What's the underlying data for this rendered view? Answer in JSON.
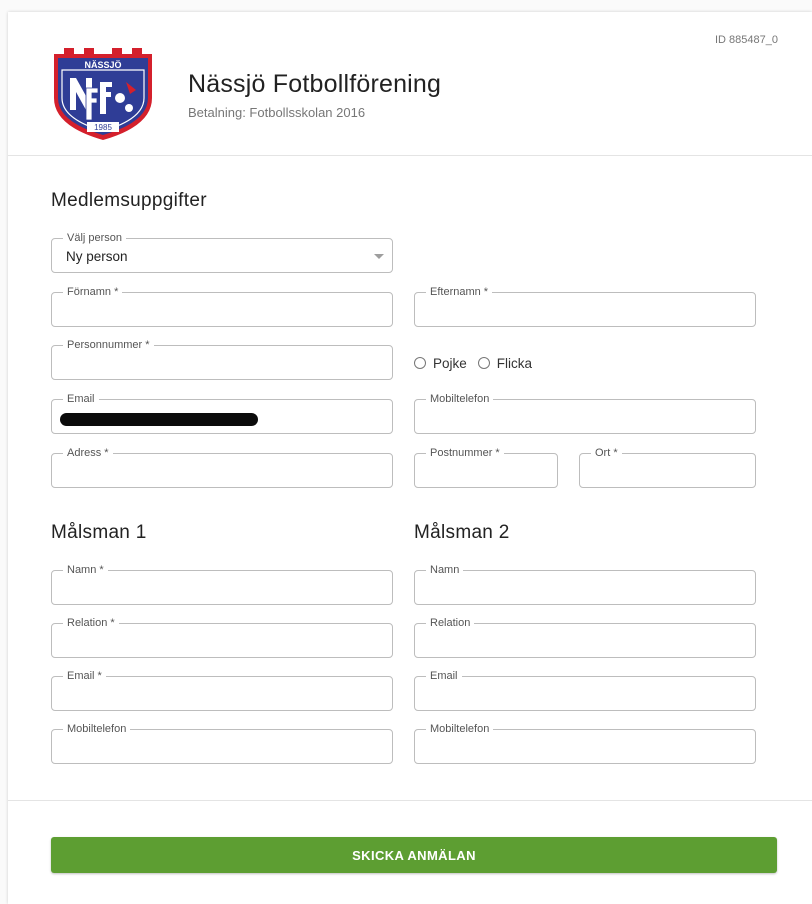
{
  "header": {
    "org_name": "Nässjö Fotbollförening",
    "subtitle": "Betalning: Fotbollsskolan 2016",
    "form_id": "ID 885487_0",
    "logo": {
      "top_text": "NÄSSJÖ",
      "monogram": "NFF",
      "year": "1985",
      "primary_color": "#2f3d96",
      "accent_color": "#d4202c"
    }
  },
  "member_section": {
    "title": "Medlemsuppgifter",
    "select_person": {
      "label": "Välj person",
      "value": "Ny person"
    },
    "first_name": {
      "label": "Förnamn *",
      "value": ""
    },
    "last_name": {
      "label": "Efternamn *",
      "value": ""
    },
    "personal_number": {
      "label": "Personnummer *",
      "value": ""
    },
    "gender_options": [
      "Pojke",
      "Flicka"
    ],
    "email": {
      "label": "Email",
      "value": ""
    },
    "mobile": {
      "label": "Mobiltelefon",
      "value": ""
    },
    "address": {
      "label": "Adress *",
      "value": ""
    },
    "postal_code": {
      "label": "Postnummer *",
      "value": ""
    },
    "city": {
      "label": "Ort *",
      "value": ""
    }
  },
  "guardian1": {
    "title": "Målsman 1",
    "name": {
      "label": "Namn *"
    },
    "relation": {
      "label": "Relation *"
    },
    "email": {
      "label": "Email *"
    },
    "mobile": {
      "label": "Mobiltelefon"
    }
  },
  "guardian2": {
    "title": "Målsman 2",
    "name": {
      "label": "Namn"
    },
    "relation": {
      "label": "Relation"
    },
    "email": {
      "label": "Email"
    },
    "mobile": {
      "label": "Mobiltelefon"
    }
  },
  "submit_label": "SKICKA ANMÄLAN",
  "colors": {
    "submit_button": "#5d9e32",
    "border": "#bdbdbd"
  }
}
